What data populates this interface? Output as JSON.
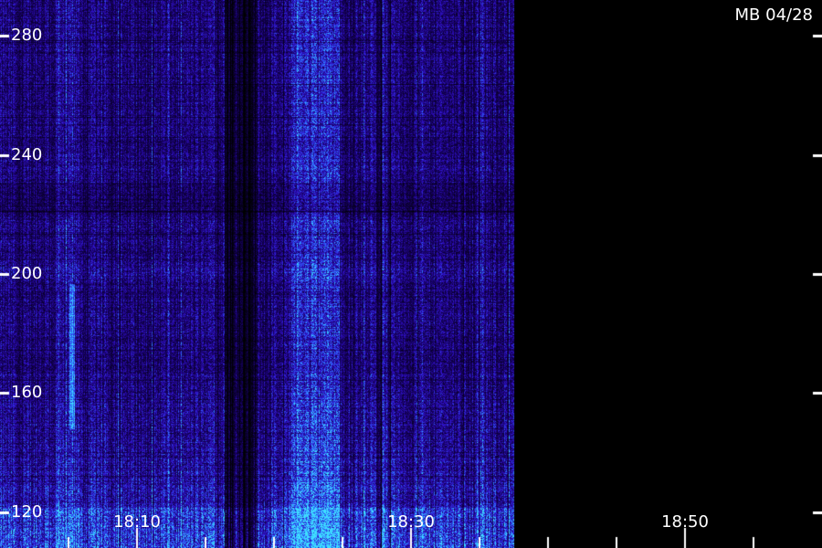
{
  "chart_data": {
    "type": "heatmap",
    "title": "MB 04/28",
    "xlabel": "",
    "ylabel": "",
    "x_tick_labels": [
      "18:10",
      "18:30",
      "18:50"
    ],
    "x_ticks_minutes": [
      1090,
      1110,
      1130
    ],
    "x_range_minutes": [
      1080,
      1140
    ],
    "data_end_minutes": 1117.5,
    "minor_tick_step_minutes": 5,
    "y_tick_labels": [
      "120",
      "160",
      "200",
      "240",
      "280"
    ],
    "y_ticks": [
      120,
      160,
      200,
      240,
      280
    ],
    "y_range": [
      108,
      292
    ],
    "colormap": [
      "#000000",
      "#14005a",
      "#3010c8",
      "#2d6cff",
      "#3fe0ff"
    ],
    "grid": false
  }
}
